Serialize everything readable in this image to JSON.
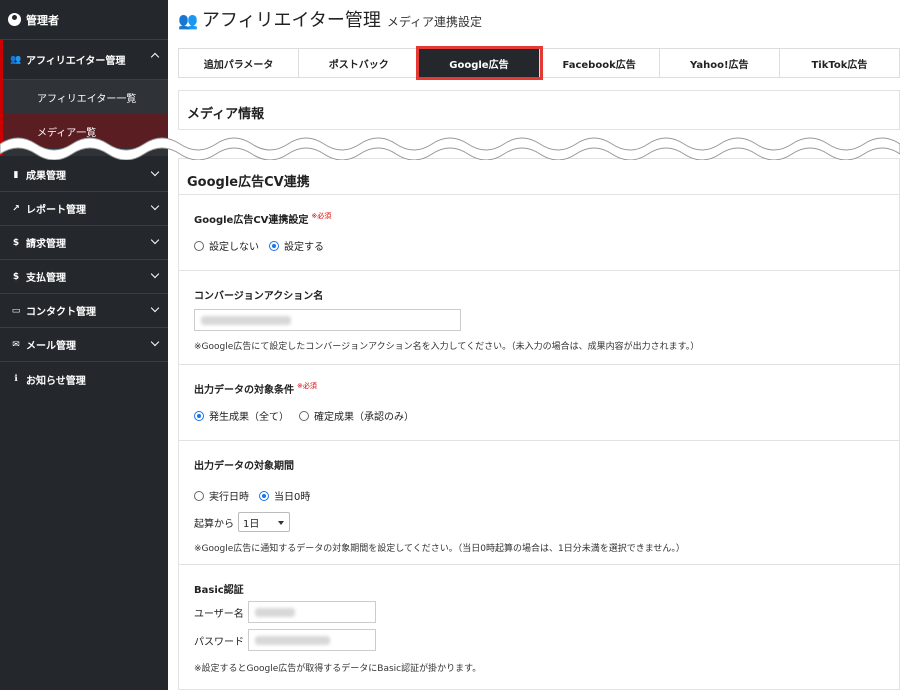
{
  "sidebar": {
    "user_label": "管理者",
    "affiliate_label": "アフィリエイター管理",
    "sub_items": [
      "アフィリエイター一覧",
      "メディア一覧"
    ],
    "items": [
      {
        "label": "成果管理",
        "icon": "bar-chart-icon"
      },
      {
        "label": "レポート管理",
        "icon": "line-chart-icon"
      },
      {
        "label": "請求管理",
        "icon": "dollar-icon"
      },
      {
        "label": "支払管理",
        "icon": "dollar-icon"
      },
      {
        "label": "コンタクト管理",
        "icon": "monitor-icon"
      },
      {
        "label": "メール管理",
        "icon": "mail-icon"
      },
      {
        "label": "お知らせ管理",
        "icon": "info-icon"
      }
    ]
  },
  "header": {
    "title": "アフィリエイター管理",
    "subtitle": "メディア連携設定"
  },
  "tabs": [
    "追加パラメータ",
    "ポストバック",
    "Google広告",
    "Facebook広告",
    "Yahoo!広告",
    "TikTok広告"
  ],
  "active_tab": "Google広告",
  "media_card": {
    "title": "メディア情報"
  },
  "google": {
    "section_title": "Google広告CV連携",
    "cv_setting": {
      "label": "Google広告CV連携設定",
      "required": "※必須",
      "options": [
        "設定しない",
        "設定する"
      ],
      "selected": "設定する"
    },
    "conversion_action": {
      "label": "コンバージョンアクション名",
      "note": "※Google広告にて設定したコンバージョンアクション名を入力してください。（未入力の場合は、成果内容が出力されます。）"
    },
    "output_condition": {
      "label": "出力データの対象条件",
      "required": "※必須",
      "options": [
        "発生成果（全て）",
        "確定成果（承認のみ）"
      ],
      "selected": "発生成果（全て）"
    },
    "output_period": {
      "label": "出力データの対象期間",
      "options": [
        "実行日時",
        "当日0時"
      ],
      "selected": "当日0時",
      "start_label": "起算から",
      "start_value": "1日",
      "note": "※Google広告に通知するデータの対象期間を設定してください。（当日0時起算の場合は、1日分未満を選択できません。）"
    },
    "basic_auth": {
      "label": "Basic認証",
      "user_label": "ユーザー名",
      "password_label": "パスワード",
      "note": "※設定するとGoogle広告が取得するデータにBasic認証が掛かります。"
    }
  },
  "colors": {
    "sidebar_bg": "#24282c",
    "active_tab_bg": "#24282c",
    "highlight": "#e53935",
    "radio_on": "#1a73e8",
    "required": "#dd0000"
  }
}
